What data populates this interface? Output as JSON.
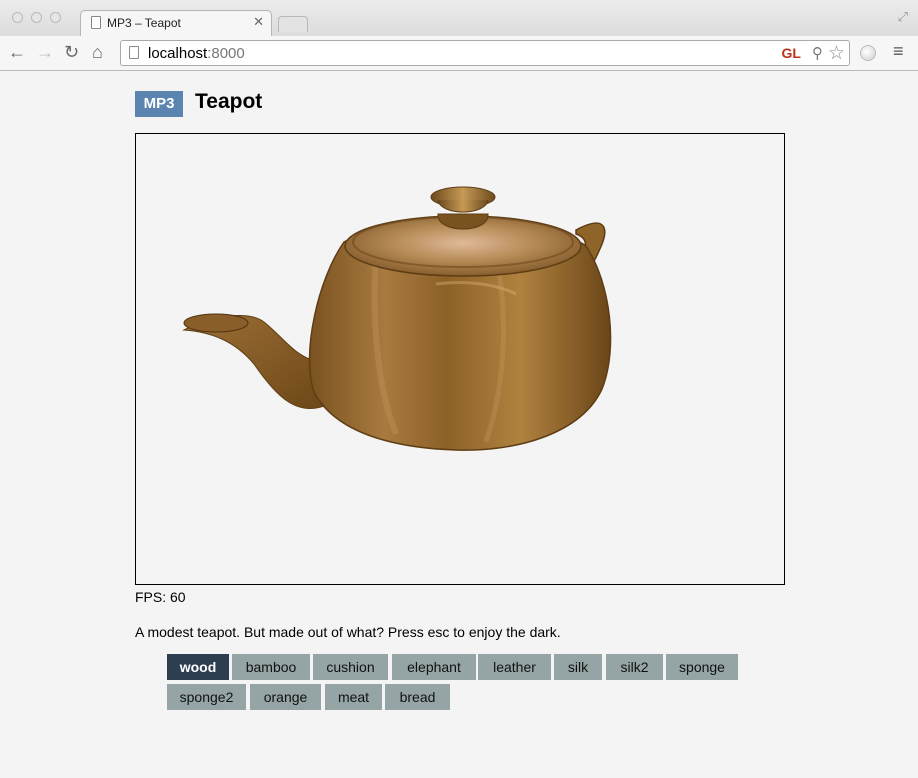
{
  "browser": {
    "tab_title": "MP3 – Teapot",
    "url_host": "localhost",
    "url_port": ":8000",
    "gl_badge": "GL"
  },
  "page": {
    "badge": "MP3",
    "title": "Teapot",
    "fps_label": "FPS: 60",
    "description": "A modest teapot. But made out of what? Press esc to enjoy the dark."
  },
  "materials": {
    "selected": "wood",
    "items": [
      "wood",
      "bamboo",
      "cushion",
      "elephant",
      "leather",
      "silk",
      "silk2",
      "sponge",
      "sponge2",
      "orange",
      "meat",
      "bread"
    ]
  },
  "colors": {
    "badge": "#5b84b0",
    "button": "#95a5a6",
    "button_active": "#2c3e50",
    "teapot": "#9a6a32"
  }
}
